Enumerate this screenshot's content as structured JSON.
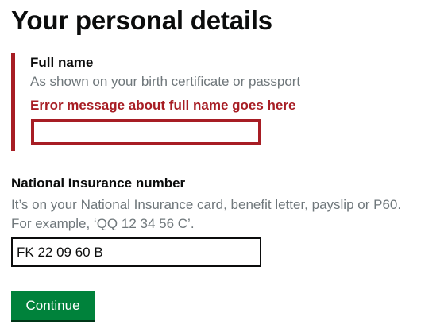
{
  "page": {
    "title": "Your personal details"
  },
  "full_name": {
    "label": "Full name",
    "hint": "As shown on your birth certificate or passport",
    "error": "Error message about full name goes here",
    "value": ""
  },
  "ni_number": {
    "label": "National Insurance number",
    "hint_line1": "It’s on your National Insurance card, benefit letter, payslip or P60.",
    "hint_line2": "For example, ‘QQ 12 34 56 C’.",
    "value": "FK 22 09 60 B"
  },
  "actions": {
    "continue_label": "Continue"
  },
  "colors": {
    "error": "#a71d24",
    "button": "#00823b",
    "hint_text": "#6f777b",
    "text": "#0b0c0c"
  }
}
